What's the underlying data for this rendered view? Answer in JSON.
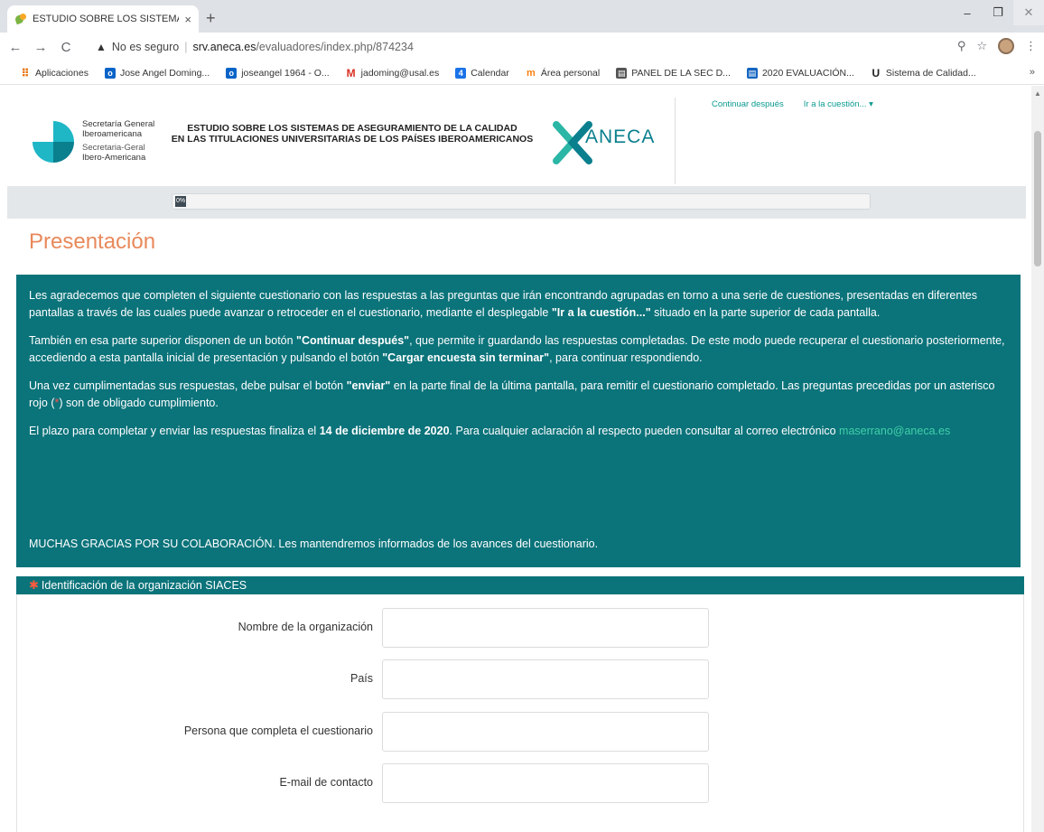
{
  "browser": {
    "tab_title": "ESTUDIO SOBRE LOS SISTEMAS",
    "tab_close": "×",
    "new_tab": "+",
    "window_controls": {
      "minimize": "–",
      "restore": "❐",
      "close": "✕"
    },
    "nav": {
      "back": "←",
      "forward": "→",
      "reload": "C"
    },
    "security_icon": "▲",
    "security_label": "No es seguro",
    "url_host": "srv.aneca.es",
    "url_path": "/evaluadores/index.php/874234",
    "bookmarks": [
      {
        "icon": "apps-icon",
        "glyph": "⠿",
        "label": "Aplicaciones"
      },
      {
        "icon": "outlook-icon",
        "glyph": "o",
        "label": "Jose Angel Doming..."
      },
      {
        "icon": "outlook-icon",
        "glyph": "o",
        "label": "joseangel 1964 - O..."
      },
      {
        "icon": "gmail-icon",
        "glyph": "M",
        "label": "jadoming@usal.es"
      },
      {
        "icon": "calendar-icon",
        "glyph": "4",
        "label": "Calendar"
      },
      {
        "icon": "moodle-icon",
        "glyph": "m",
        "label": "Área personal"
      },
      {
        "icon": "panel-icon",
        "glyph": "▤",
        "label": "PANEL DE LA SEC D..."
      },
      {
        "icon": "evaluacion-icon",
        "glyph": "▤",
        "label": "2020 EVALUACIÓN..."
      },
      {
        "icon": "u-icon",
        "glyph": "U",
        "label": "Sistema de Calidad..."
      }
    ],
    "bookmarks_more": "»"
  },
  "header": {
    "org_name_1": "Secretaría General",
    "org_name_2": "Iberoamericana",
    "org_name_3": "Secretaria-Geral",
    "org_name_4": "Ibero-Americana",
    "study_title_1": "ESTUDIO SOBRE LOS SISTEMAS DE ASEGURAMIENTO DE LA CALIDAD",
    "study_title_2": "EN LAS TITULACIONES UNIVERSITARIAS DE LOS PAÍSES IBEROAMERICANOS",
    "aneca": "ANECA",
    "continue_later": "Continuar después",
    "go_to_question": "Ir a la cuestión... ▾"
  },
  "progress": {
    "value": 0,
    "label": "0%"
  },
  "page": {
    "title": "Presentación",
    "intro": {
      "p1_a": "Les agradecemos que completen el siguiente cuestionario con las respuestas a las preguntas que irán encontrando agrupadas en torno a una serie de cuestiones, presentadas en diferentes pantallas a través de las cuales puede avanzar o retroceder en el cuestionario, mediante el desplegable ",
      "p1_b": "\"Ir a la cuestión...\"",
      "p1_c": " situado en la parte superior de cada pantalla.",
      "p2_a": "También en esa parte superior disponen de un botón ",
      "p2_b": "\"Continuar después\"",
      "p2_c": ", que permite ir guardando las respuestas completadas. De este modo puede recuperar el cuestionario posteriormente, accediendo a esta pantalla inicial de presentación y pulsando el botón ",
      "p2_d": "\"Cargar encuesta sin terminar\"",
      "p2_e": ", para continuar respondiendo.",
      "p3_a": "Una vez cumplimentadas sus respuestas, debe pulsar el botón ",
      "p3_b": "\"enviar\"",
      "p3_c": " en la parte final de la última pantalla, para remitir el cuestionario completado. Las preguntas precedidas por un asterisco rojo (",
      "p3_d": "*",
      "p3_e": ") son de obligado cumplimiento.",
      "p4_a": "El plazo para completar y enviar las respuestas finaliza el ",
      "p4_b": "14 de diciembre de 2020",
      "p4_c": ". Para cualquier aclaración al respecto pueden consultar al correo electrónico ",
      "p4_email": "maserrano@aneca.es",
      "thanks": "MUCHAS GRACIAS POR SU COLABORACIÓN. Les mantendremos informados de los avances del cuestionario."
    },
    "section": {
      "required_mark": "✱",
      "title": "Identificación de la organización SIACES"
    },
    "fields": [
      {
        "label": "Nombre de la organización",
        "value": ""
      },
      {
        "label": "País",
        "value": ""
      },
      {
        "label": "Persona que completa el cuestionario",
        "value": ""
      },
      {
        "label": "E-mail de contacto",
        "value": ""
      }
    ]
  },
  "colors": {
    "teal": "#0b737a",
    "title_orange": "#e8895b",
    "link_green": "#0a9a90",
    "email_green": "#3fd1a8",
    "required_red": "#ff5a3c"
  }
}
